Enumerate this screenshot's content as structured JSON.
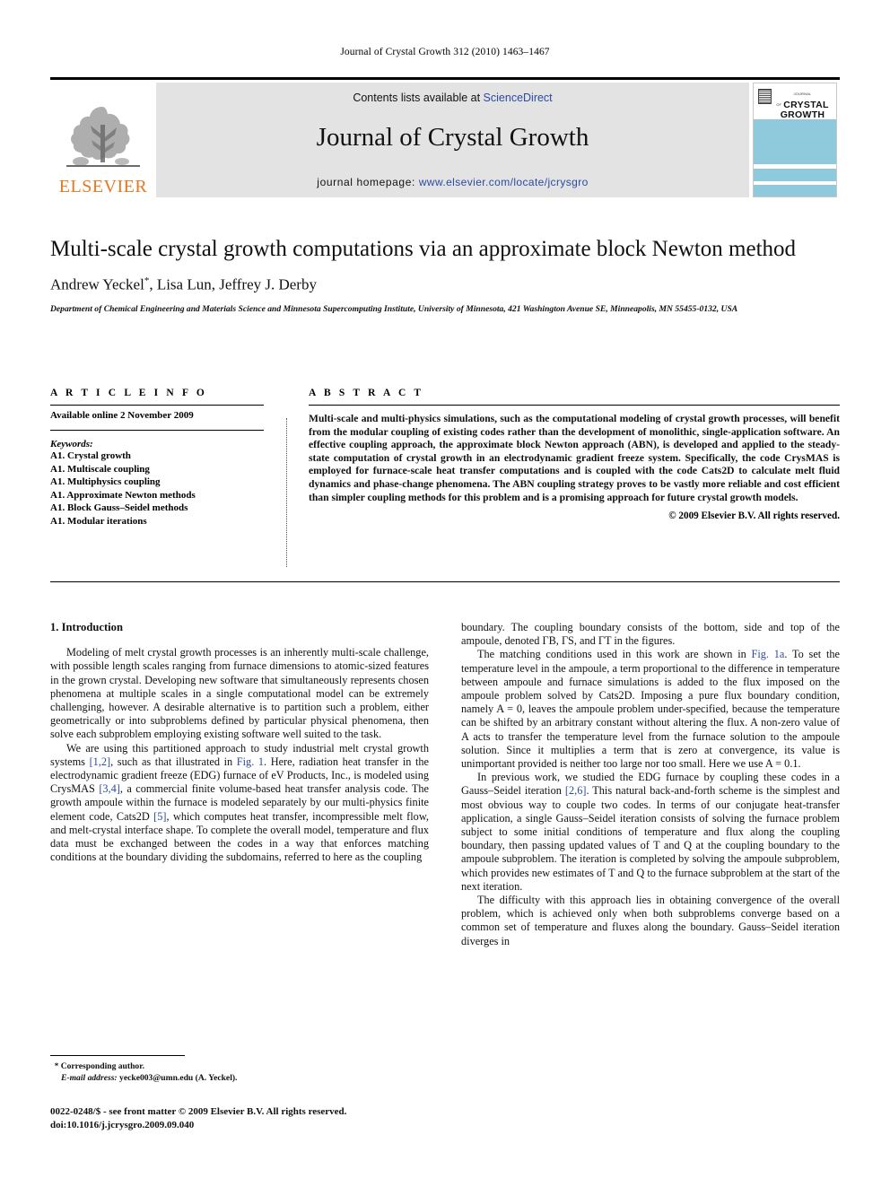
{
  "running_head": "Journal of Crystal Growth 312 (2010) 1463–1467",
  "masthead": {
    "contents_prefix": "Contents lists available at ",
    "sciencedirect": "ScienceDirect",
    "journal_title": "Journal of Crystal Growth",
    "homepage_prefix": "journal homepage: ",
    "homepage_url": "www.elsevier.com/locate/jcrysgro",
    "publisher_wordmark": "ELSEVIER",
    "publisher_color": "#E87722",
    "link_color": "#2b4ba0",
    "panel_color": "#e3e3e3",
    "cover": {
      "kicker": "JOURNAL OF",
      "line1": "CRYSTAL",
      "line2": "GROWTH",
      "band_color": "#8fc9dc"
    }
  },
  "article": {
    "title": "Multi-scale crystal growth computations via an approximate block Newton method",
    "authors": "Andrew Yeckel*, Lisa Lun, Jeffrey J. Derby",
    "affiliation": "Department of Chemical Engineering and Materials Science and Minnesota Supercomputing Institute, University of Minnesota, 421 Washington Avenue SE, Minneapolis, MN 55455-0132, USA"
  },
  "article_info": {
    "heading": "A R T I C L E   I N F O",
    "available_online": "Available online 2 November 2009",
    "keywords_label": "Keywords:",
    "keywords": [
      "A1. Crystal growth",
      "A1. Multiscale coupling",
      "A1. Multiphysics coupling",
      "A1. Approximate Newton methods",
      "A1. Block Gauss–Seidel methods",
      "A1. Modular iterations"
    ]
  },
  "abstract": {
    "heading": "A B S T R A C T",
    "text": "Multi-scale and multi-physics simulations, such as the computational modeling of crystal growth processes, will benefit from the modular coupling of existing codes rather than the development of monolithic, single-application software. An effective coupling approach, the approximate block Newton approach (ABN), is developed and applied to the steady-state computation of crystal growth in an electrodynamic gradient freeze system. Specifically, the code CrysMAS is employed for furnace-scale heat transfer computations and is coupled with the code Cats2D to calculate melt fluid dynamics and phase-change phenomena. The ABN coupling strategy proves to be vastly more reliable and cost efficient than simpler coupling methods for this problem and is a promising approach for future crystal growth models.",
    "copyright": "© 2009 Elsevier B.V. All rights reserved."
  },
  "body": {
    "section_number_title": "1.  Introduction",
    "left_paragraphs": [
      "Modeling of melt crystal growth processes is an inherently multi-scale challenge, with possible length scales ranging from furnace dimensions to atomic-sized features in the grown crystal. Developing new software that simultaneously represents chosen phenomena at multiple scales in a single computational model can be extremely challenging, however. A desirable alternative is to partition such a problem, either geometrically or into subproblems defined by particular physical phenomena, then solve each subproblem employing existing software well suited to the task."
    ],
    "left_p2_segments": [
      "We are using this partitioned approach to study industrial melt crystal growth systems ",
      "[1,2]",
      ", such as that illustrated in ",
      "Fig. 1",
      ". Here, radiation heat transfer in the electrodynamic gradient freeze (EDG) furnace of eV Products, Inc., is modeled using CrysMAS ",
      "[3,4]",
      ", a commercial finite volume-based heat transfer analysis code. The growth ampoule within the furnace is modeled separately by our multi-physics finite element code, Cats2D ",
      "[5]",
      ", which computes heat transfer, incompressible melt flow, and melt-crystal interface shape. To complete the overall model, temperature and flux data must be exchanged between the codes in a way that enforces matching conditions at the boundary dividing the subdomains, referred to here as the coupling"
    ],
    "right_p1": "boundary. The coupling boundary consists of the bottom, side and top of the ampoule, denoted ΓB, ΓS, and ΓT in the figures.",
    "right_p2_segments": [
      "The matching conditions used in this work are shown in ",
      "Fig. 1a",
      ". To set the temperature level in the ampoule, a term proportional to the difference in temperature between ampoule and furnace simulations is added to the flux imposed on the ampoule problem solved by Cats2D. Imposing a pure flux boundary condition, namely A = 0, leaves the ampoule problem under-specified, because the temperature can be shifted by an arbitrary constant without altering the flux. A non-zero value of A acts to transfer the temperature level from the furnace solution to the ampoule solution. Since it multiplies a term that is zero at convergence, its value is unimportant provided is neither too large nor too small. Here we use A = 0.1."
    ],
    "right_p3_segments": [
      "In previous work, we studied the EDG furnace by coupling these codes in a Gauss–Seidel iteration ",
      "[2,6]",
      ". This natural back-and-forth scheme is the simplest and most obvious way to couple two codes. In terms of our conjugate heat-transfer application, a single Gauss–Seidel iteration consists of solving the furnace problem subject to some initial conditions of temperature and flux along the coupling boundary, then passing updated values of T and Q at the coupling boundary to the ampoule subproblem. The iteration is completed by solving the ampoule subproblem, which provides new estimates of T and Q to the furnace subproblem at the start of the next iteration."
    ],
    "right_p4": "The difficulty with this approach lies in obtaining convergence of the overall problem, which is achieved only when both subproblems converge based on a common set of temperature and fluxes along the boundary. Gauss–Seidel iteration diverges in"
  },
  "footer": {
    "corresponding_marker": "*",
    "corresponding_author": "Corresponding author.",
    "email_label": "E-mail address:",
    "email_value": "yecke003@umn.edu (A. Yeckel).",
    "front_matter": "0022-0248/$ - see front matter © 2009 Elsevier B.V. All rights reserved.",
    "doi": "doi:10.1016/j.jcrysgro.2009.09.040"
  }
}
